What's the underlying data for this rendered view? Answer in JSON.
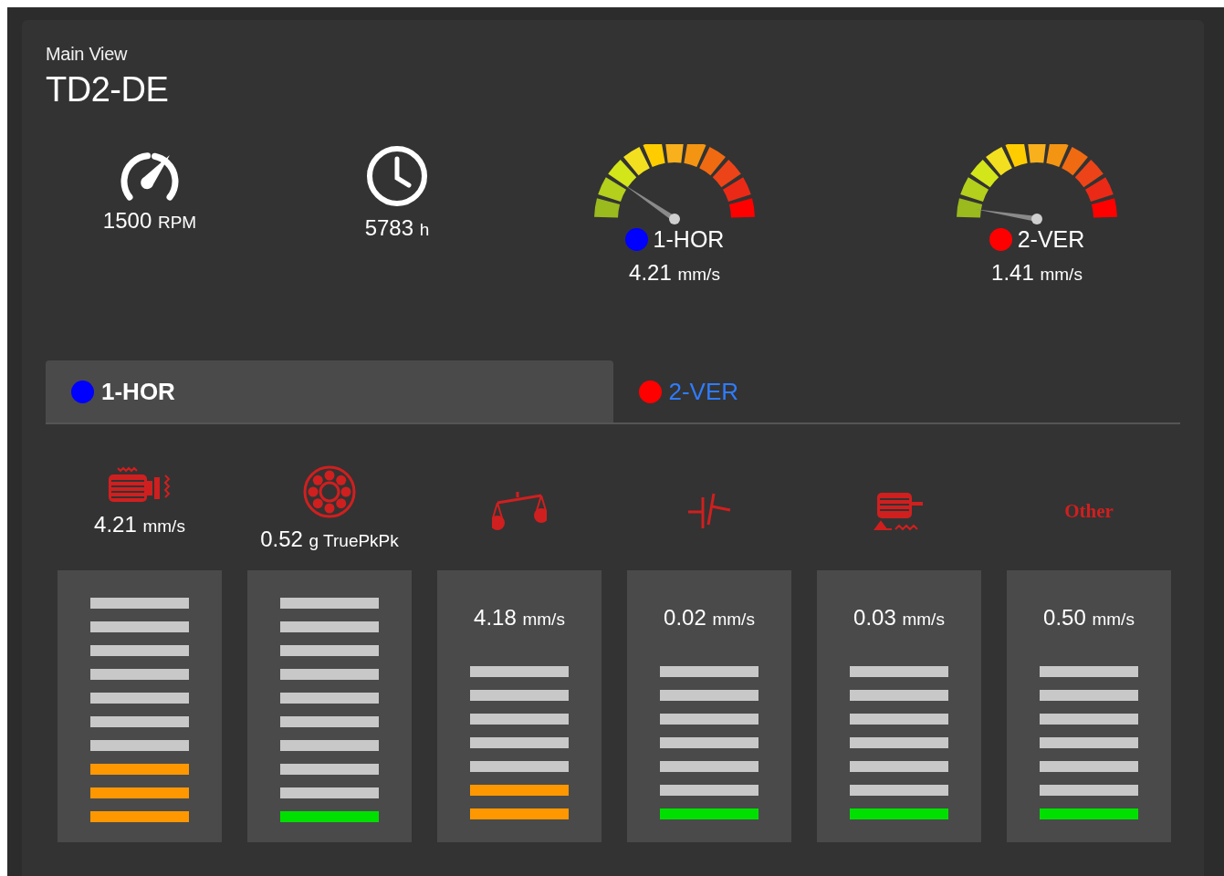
{
  "header": {
    "subtitle": "Main View",
    "title": "TD2-DE"
  },
  "stats": [
    {
      "kind": "speed",
      "value": "1500",
      "unit": "RPM"
    },
    {
      "kind": "hours",
      "value": "5783",
      "unit": "h"
    }
  ],
  "gauges": [
    {
      "channel": "1-HOR",
      "color": "#0000ff",
      "value": "4.21",
      "unit": "mm/s"
    },
    {
      "channel": "2-VER",
      "color": "#ff0000",
      "value": "1.41",
      "unit": "mm/s"
    }
  ],
  "tabs": [
    {
      "label": "1-HOR",
      "color": "#0000ff",
      "selected": true
    },
    {
      "label": "2-VER",
      "color": "#ff0000",
      "selected": false
    }
  ],
  "metrics": [
    {
      "kind": "motor",
      "value": "4.21",
      "unit": "mm/s",
      "level": 0.3,
      "color": "#ff9800"
    },
    {
      "kind": "bearing",
      "value": "0.52",
      "unit": "g TruePkPk",
      "level": 0.1,
      "color": "#00e000"
    },
    {
      "kind": "balance",
      "value": "4.18",
      "unit": "mm/s",
      "level": 0.286,
      "color": "#ff9800"
    },
    {
      "kind": "coupling",
      "value": "0.02",
      "unit": "mm/s",
      "level": 0.143,
      "color": "#00e000"
    },
    {
      "kind": "looseness",
      "value": "0.03",
      "unit": "mm/s",
      "level": 0.143,
      "color": "#00e000"
    },
    {
      "kind": "text",
      "label": "Other",
      "value": "0.50",
      "unit": "mm/s",
      "level": 0.143,
      "color": "#00e000"
    }
  ]
}
